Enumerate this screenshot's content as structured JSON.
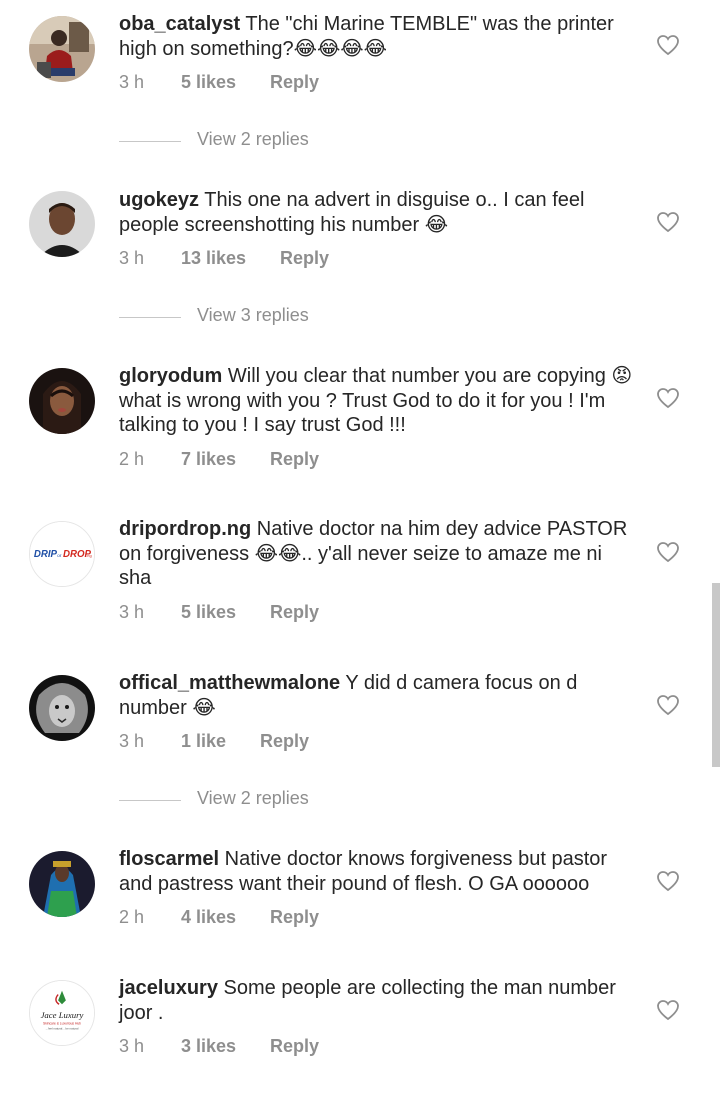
{
  "comments": [
    {
      "user": "oba_catalyst",
      "text": "The \"chi Marine TEMBLE\" was the printer high on something?😂😂😂😂",
      "time": "3 h",
      "likes": "5 likes",
      "reply": "Reply",
      "view_replies": "View 2 replies"
    },
    {
      "user": "ugokeyz",
      "text": "This one na advert in disguise o.. I can feel people screenshotting his number 😂",
      "time": "3 h",
      "likes": "13 likes",
      "reply": "Reply",
      "view_replies": "View 3 replies"
    },
    {
      "user": "gloryodum",
      "text": "Will you clear that number you are copying 😡 what is wrong with you ? Trust God to do it for you ! I'm talking to you ! I say trust God !!!",
      "time": "2 h",
      "likes": "7 likes",
      "reply": "Reply"
    },
    {
      "user": "dripordrop.ng",
      "text": "Native doctor na him dey advice PASTOR on forgiveness 😂😂.. y'all never seize to amaze me ni sha",
      "time": "3 h",
      "likes": "5 likes",
      "reply": "Reply"
    },
    {
      "user": "offical_matthewmalone",
      "text": "Y did d camera focus on d number 😂",
      "time": "3 h",
      "likes": "1 like",
      "reply": "Reply",
      "view_replies": "View 2 replies"
    },
    {
      "user": "floscarmel",
      "text": "Native doctor knows forgiveness but pastor and pastress want their pound of flesh.  O GA oooooo",
      "time": "2 h",
      "likes": "4 likes",
      "reply": "Reply"
    },
    {
      "user": "jaceluxury",
      "text": "Some people are collecting the man number joor .",
      "time": "3 h",
      "likes": "3 likes",
      "reply": "Reply"
    }
  ],
  "avatar_logos": {
    "drip": "DRIP",
    "drip_mid": "or",
    "drop": "DROP",
    "drop_suffix": ".ng",
    "jace_title": "Jace Luxury",
    "jace_line1": "Skincare & Luxurious Hub",
    "jace_line2": "...feel natural... be natural"
  },
  "colors": {
    "text": "#262626",
    "meta": "#8e8e8e",
    "divider": "#c7c7c7"
  },
  "icons": {
    "like": "heart-outline-icon"
  }
}
